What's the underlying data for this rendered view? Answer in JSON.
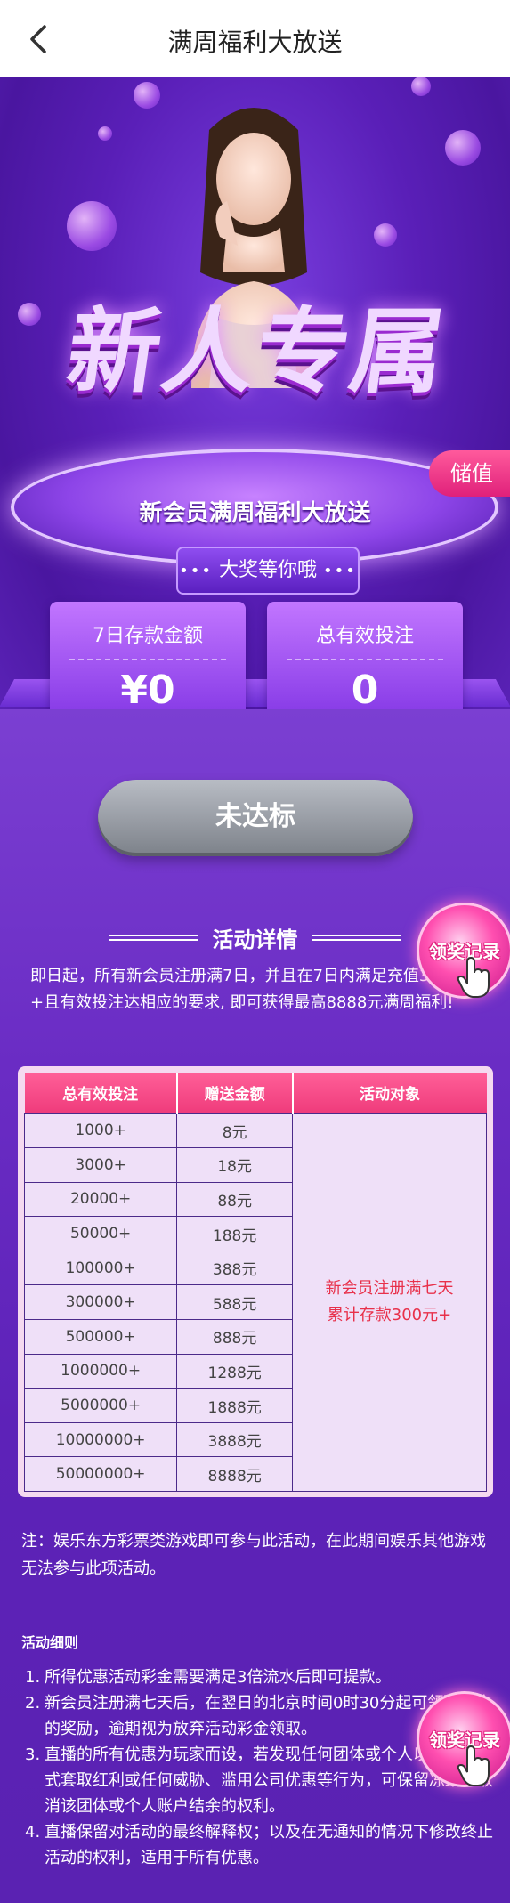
{
  "header": {
    "title": "满周福利大放送"
  },
  "hero": {
    "title": "新人专属",
    "subtitle": "新会员满周福利大放送",
    "prize": "大奖等你哦",
    "deposit_tab": "储值"
  },
  "stats": [
    {
      "label": "7日存款金额",
      "value": "¥0"
    },
    {
      "label": "总有效投注",
      "value": "0"
    }
  ],
  "status_button": "未达标",
  "details": {
    "title": "活动详情",
    "intro": "即日起，所有新会员注册满7日，并且在7日内满足充值300元+且有效投注达相应的要求, 即可获得最高8888元满周福利!"
  },
  "float_button_label": "领奖记录",
  "table": {
    "headers": [
      "总有效投注",
      "赠送金额",
      "活动对象"
    ],
    "rows": [
      [
        "1000+",
        "8元"
      ],
      [
        "3000+",
        "18元"
      ],
      [
        "20000+",
        "88元"
      ],
      [
        "50000+",
        "188元"
      ],
      [
        "100000+",
        "388元"
      ],
      [
        "300000+",
        "588元"
      ],
      [
        "500000+",
        "888元"
      ],
      [
        "1000000+",
        "1288元"
      ],
      [
        "5000000+",
        "1888元"
      ],
      [
        "10000000+",
        "3888元"
      ],
      [
        "50000000+",
        "8888元"
      ]
    ],
    "target_line1": "新会员注册满七天",
    "target_line2": "累计存款300元+"
  },
  "note": "注：娱乐东方彩票类游戏即可参与此活动，在此期间娱乐其他游戏无法参与此项活动。",
  "rules": {
    "title": "活动细则",
    "items": [
      "所得优惠活动彩金需要满足3倍流水后即可提款。",
      "新会员注册满七天后，在翌日的北京时间0时30分起可领取相应的奖励，逾期视为放弃活动彩金领取。",
      "直播的所有优惠为玩家而设，若发现任何团体或个人以不诚实方式套取红利或任何威胁、滥用公司优惠等行为，可保留冻结、取消该团体或个人账户结余的权利。",
      "直播保留对活动的最终解释权；以及在无通知的情况下修改终止活动的权利，适用于所有优惠。"
    ]
  }
}
